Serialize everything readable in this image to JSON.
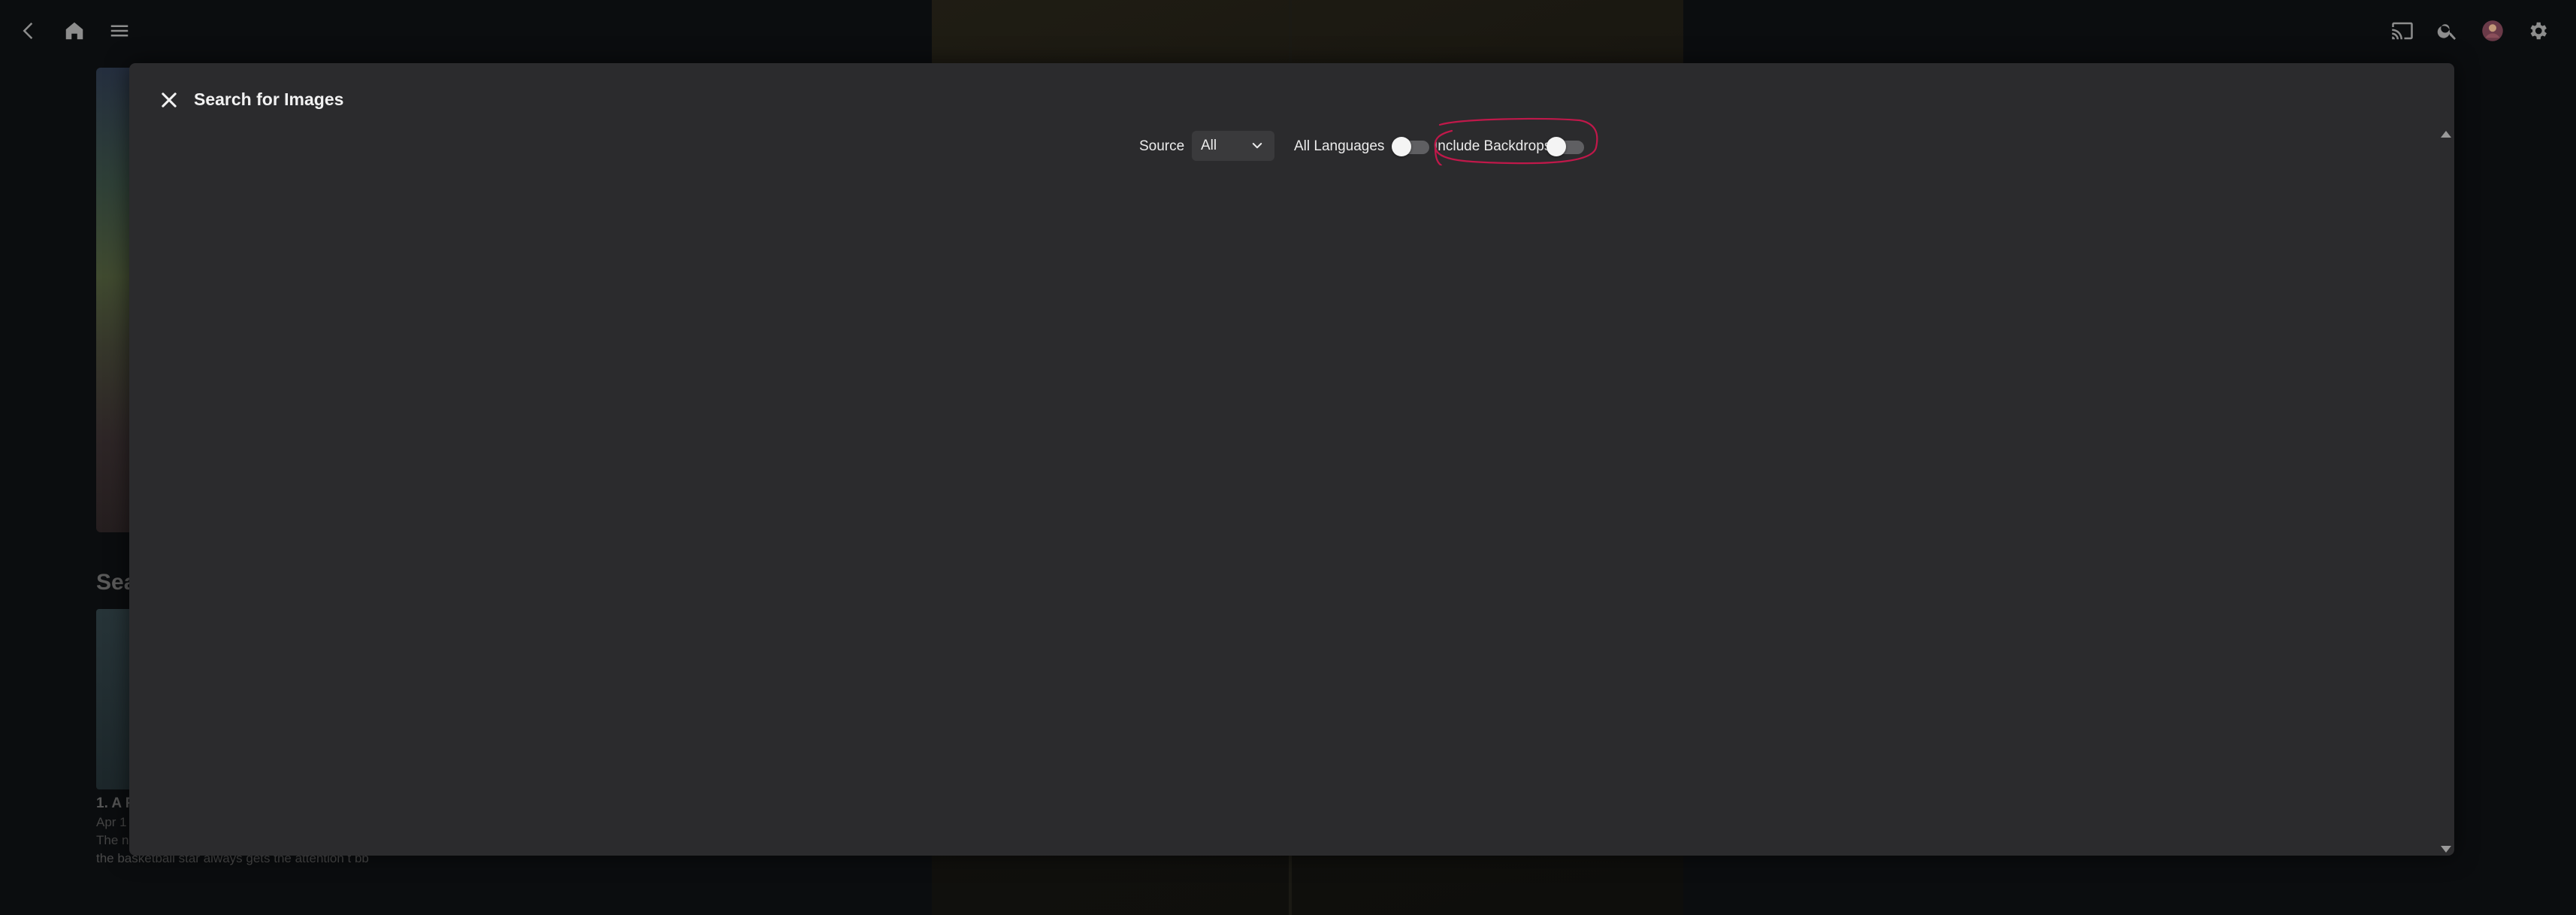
{
  "background": {
    "season_heading": "Sea",
    "episode_title": "1. A F",
    "episode_date": "Apr 1",
    "episode_desc_line1": "The n",
    "episode_desc_line2": "the basketball star always gets the attention t bb"
  },
  "topbar": {
    "back_icon": "arrow-back-icon",
    "home_icon": "home-icon",
    "menu_icon": "menu-icon",
    "cast_icon": "cast-icon",
    "search_icon": "search-icon",
    "avatar_icon": "avatar-icon",
    "settings_icon": "gear-icon"
  },
  "dialog": {
    "title": "Search for Images",
    "close_icon": "close-icon"
  },
  "filters": {
    "source_label": "Source",
    "source_value": "All",
    "all_languages_label": "All Languages",
    "all_languages_on": false,
    "include_backdrops_label": "Include Backdrops",
    "include_backdrops_on": false
  },
  "colors": {
    "dialog_bg": "#2b2b2d",
    "annotation": "#c0184a",
    "page_bg": "#0b0d0f"
  }
}
